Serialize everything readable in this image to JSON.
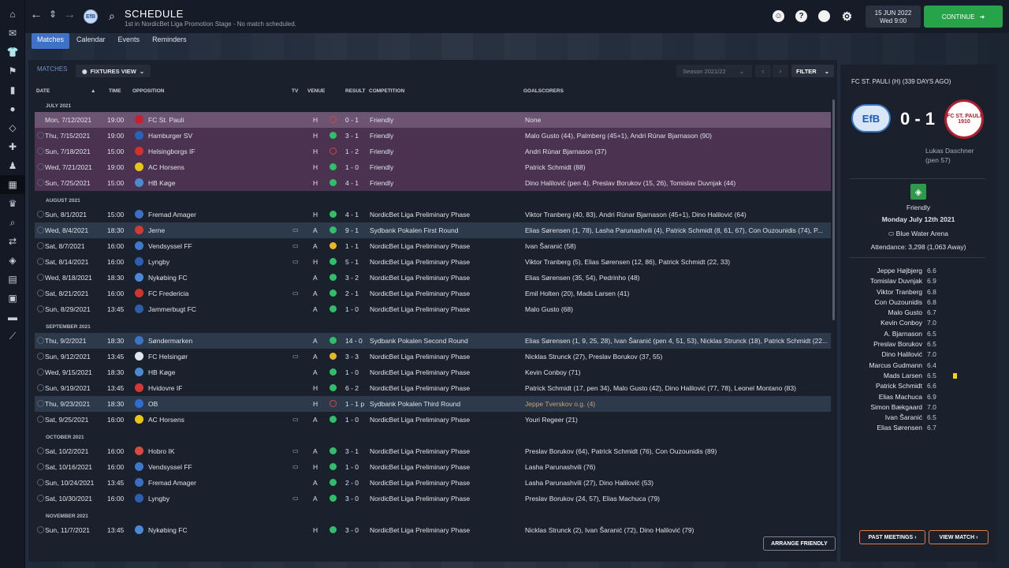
{
  "header": {
    "title": "SCHEDULE",
    "subtitle": "1st in NordicBet Liga Promotion Stage - No match scheduled.",
    "date": "15 JUN 2022",
    "day_time": "Wed 9:00",
    "continue_label": "CONTINUE",
    "club_badge_text": "EfB"
  },
  "tabs": [
    "Matches",
    "Calendar",
    "Events",
    "Reminders"
  ],
  "main": {
    "section_label": "MATCHES",
    "view_label": "FIXTURES VIEW",
    "season": "Season 2021/22",
    "filter_label": "FILTER",
    "arrange_label": "ARRANGE FRIENDLY",
    "columns": {
      "date": "DATE",
      "time": "TIME",
      "opposition": "OPPOSITION",
      "tv": "TV",
      "venue": "VENUE",
      "result": "RESULT",
      "competition": "COMPETITION",
      "goalscorers": "GOALSCORERS"
    }
  },
  "months": [
    {
      "label": "JULY 2021",
      "matches": [
        {
          "date": "Mon, 7/12/2021",
          "time": "19:00",
          "opp": "FC St. Pauli",
          "badge": "#c8202f",
          "tv": "",
          "venue": "H",
          "res": "L",
          "score": "0 - 1",
          "comp": "Friendly",
          "goals": "None",
          "style": "friendly sel"
        },
        {
          "date": "Thu, 7/15/2021",
          "time": "19:00",
          "opp": "Hamburger SV",
          "badge": "#2a62b8",
          "tv": "",
          "venue": "H",
          "res": "W",
          "score": "3 - 1",
          "comp": "Friendly",
          "goals": "Malo Gusto (44), Palmberg (45+1), Andri Rúnar Bjarnason (90)",
          "style": "friendly"
        },
        {
          "date": "Sun, 7/18/2021",
          "time": "15:00",
          "opp": "Helsingborgs IF",
          "badge": "#d3312d",
          "tv": "",
          "venue": "H",
          "res": "L",
          "score": "1 - 2",
          "comp": "Friendly",
          "goals": "Andri Rúnar Bjarnason (37)",
          "style": "friendly"
        },
        {
          "date": "Wed, 7/21/2021",
          "time": "19:00",
          "opp": "AC Horsens",
          "badge": "#e6c619",
          "tv": "",
          "venue": "H",
          "res": "W",
          "score": "1 - 0",
          "comp": "Friendly",
          "goals": "Patrick Schmidt (88)",
          "style": "friendly"
        },
        {
          "date": "Sun, 7/25/2021",
          "time": "15:00",
          "opp": "HB Køge",
          "badge": "#4a8ad0",
          "tv": "",
          "venue": "H",
          "res": "W",
          "score": "4 - 1",
          "comp": "Friendly",
          "goals": "Dino Halilović (pen 4), Preslav Borukov (15, 26), Tomislav Duvnjak (44)",
          "style": "friendly"
        }
      ]
    },
    {
      "label": "AUGUST 2021",
      "matches": [
        {
          "date": "Sun, 8/1/2021",
          "time": "15:00",
          "opp": "Fremad Amager",
          "badge": "#3a6fc4",
          "tv": "",
          "venue": "H",
          "res": "W",
          "score": "4 - 1",
          "comp": "NordicBet Liga Preliminary Phase",
          "goals": "Viktor Tranberg (40, 83), Andri Rúnar Bjarnason (45+1), Dino Halilović (64)",
          "style": ""
        },
        {
          "date": "Wed, 8/4/2021",
          "time": "18:30",
          "opp": "Jerne",
          "badge": "#d23a34",
          "tv": "▭",
          "venue": "A",
          "res": "W",
          "score": "9 - 1",
          "comp": "Sydbank Pokalen First Round",
          "goals": "Elias Sørensen (1, 78), Lasha Parunashvili (4), Patrick Schmidt (8, 61, 67), Con Ouzounidis (74), P...",
          "style": "cup"
        },
        {
          "date": "Sat, 8/7/2021",
          "time": "16:00",
          "opp": "Vendsyssel FF",
          "badge": "#3d78cc",
          "tv": "▭",
          "venue": "A",
          "res": "D",
          "score": "1 - 1",
          "comp": "NordicBet Liga Preliminary Phase",
          "goals": "Ivan Šaranić (58)",
          "style": ""
        },
        {
          "date": "Sat, 8/14/2021",
          "time": "16:00",
          "opp": "Lyngby",
          "badge": "#2c5fb0",
          "tv": "▭",
          "venue": "H",
          "res": "W",
          "score": "5 - 1",
          "comp": "NordicBet Liga Preliminary Phase",
          "goals": "Viktor Tranberg (5), Elias Sørensen (12, 86), Patrick Schmidt (22, 33)",
          "style": ""
        },
        {
          "date": "Wed, 8/18/2021",
          "time": "18:30",
          "opp": "Nykøbing FC",
          "badge": "#4a88d8",
          "tv": "",
          "venue": "A",
          "res": "W",
          "score": "3 - 2",
          "comp": "NordicBet Liga Preliminary Phase",
          "goals": "Elias Sørensen (35, 54), Pedrinho (48)",
          "style": ""
        },
        {
          "date": "Sat, 8/21/2021",
          "time": "16:00",
          "opp": "FC Fredericia",
          "badge": "#d0342e",
          "tv": "▭",
          "venue": "A",
          "res": "W",
          "score": "2 - 1",
          "comp": "NordicBet Liga Preliminary Phase",
          "goals": "Emil Holten (20), Mads Larsen (41)",
          "style": ""
        },
        {
          "date": "Sun, 8/29/2021",
          "time": "13:45",
          "opp": "Jammerbugt FC",
          "badge": "#2d5ea8",
          "tv": "",
          "venue": "A",
          "res": "W",
          "score": "1 - 0",
          "comp": "NordicBet Liga Preliminary Phase",
          "goals": "Malo Gusto (68)",
          "style": ""
        }
      ]
    },
    {
      "label": "SEPTEMBER 2021",
      "matches": [
        {
          "date": "Thu, 9/2/2021",
          "time": "18:30",
          "opp": "Søndermarken",
          "badge": "#3a74c8",
          "tv": "",
          "venue": "A",
          "res": "W",
          "score": "14 - 0",
          "comp": "Sydbank Pokalen Second Round",
          "goals": "Elias Sørensen (1, 9, 25, 28), Ivan Šaranić (pen 4, 51, 53), Nicklas Strunck (18), Patrick Schmidt (22...",
          "style": "cup"
        },
        {
          "date": "Sun, 9/12/2021",
          "time": "13:45",
          "opp": "FC Helsingør",
          "badge": "#e0e6ee",
          "tv": "▭",
          "venue": "A",
          "res": "D",
          "score": "3 - 3",
          "comp": "NordicBet Liga Preliminary Phase",
          "goals": "Nicklas Strunck (27), Preslav Borukov (37, 55)",
          "style": ""
        },
        {
          "date": "Wed, 9/15/2021",
          "time": "18:30",
          "opp": "HB Køge",
          "badge": "#4a8ad0",
          "tv": "",
          "venue": "A",
          "res": "W",
          "score": "1 - 0",
          "comp": "NordicBet Liga Preliminary Phase",
          "goals": "Kevin Conboy (71)",
          "style": ""
        },
        {
          "date": "Sun, 9/19/2021",
          "time": "13:45",
          "opp": "Hvidovre IF",
          "badge": "#d43a33",
          "tv": "",
          "venue": "H",
          "res": "W",
          "score": "6 - 2",
          "comp": "NordicBet Liga Preliminary Phase",
          "goals": "Patrick Schmidt (17, pen 34), Malo Gusto (42), Dino Halilović (77, 78), Leonel Montano (83)",
          "style": ""
        },
        {
          "date": "Thu, 9/23/2021",
          "time": "18:30",
          "opp": "OB",
          "badge": "#2f6ed0",
          "tv": "",
          "venue": "H",
          "res": "L",
          "score": "1 - 1 p",
          "comp": "Sydbank Pokalen Third Round",
          "goals": "Jeppe Tverskov o.g. (4)",
          "style": "cup og"
        },
        {
          "date": "Sat, 9/25/2021",
          "time": "16:00",
          "opp": "AC Horsens",
          "badge": "#e6c619",
          "tv": "▭",
          "venue": "A",
          "res": "W",
          "score": "1 - 0",
          "comp": "NordicBet Liga Preliminary Phase",
          "goals": "Youri Regeer (21)",
          "style": ""
        }
      ]
    },
    {
      "label": "OCTOBER 2021",
      "matches": [
        {
          "date": "Sat, 10/2/2021",
          "time": "16:00",
          "opp": "Hobro IK",
          "badge": "#d74a3f",
          "tv": "▭",
          "venue": "A",
          "res": "W",
          "score": "3 - 1",
          "comp": "NordicBet Liga Preliminary Phase",
          "goals": "Preslav Borukov (64), Patrick Schmidt (76), Con Ouzounidis (89)",
          "style": ""
        },
        {
          "date": "Sat, 10/16/2021",
          "time": "16:00",
          "opp": "Vendsyssel FF",
          "badge": "#3d78cc",
          "tv": "▭",
          "venue": "H",
          "res": "W",
          "score": "1 - 0",
          "comp": "NordicBet Liga Preliminary Phase",
          "goals": "Lasha Parunashvili (76)",
          "style": ""
        },
        {
          "date": "Sun, 10/24/2021",
          "time": "13:45",
          "opp": "Fremad Amager",
          "badge": "#3a6fc4",
          "tv": "",
          "venue": "A",
          "res": "W",
          "score": "2 - 0",
          "comp": "NordicBet Liga Preliminary Phase",
          "goals": "Lasha Parunashvili (27), Dino Halilović (53)",
          "style": ""
        },
        {
          "date": "Sat, 10/30/2021",
          "time": "16:00",
          "opp": "Lyngby",
          "badge": "#2c5fb0",
          "tv": "▭",
          "venue": "A",
          "res": "W",
          "score": "3 - 0",
          "comp": "NordicBet Liga Preliminary Phase",
          "goals": "Preslav Borukov (24, 57), Elias Machuca (79)",
          "style": ""
        }
      ]
    },
    {
      "label": "NOVEMBER 2021",
      "matches": [
        {
          "date": "Sun, 11/7/2021",
          "time": "13:45",
          "opp": "Nykøbing FC",
          "badge": "#4a88d8",
          "tv": "",
          "venue": "H",
          "res": "W",
          "score": "3 - 0",
          "comp": "NordicBet Liga Preliminary Phase",
          "goals": "Nicklas Strunck (2), Ivan Šaranić (72), Dino Halilović (79)",
          "style": ""
        }
      ]
    }
  ],
  "panel": {
    "title": "FC ST. PAULI (H) (339 DAYS AGO)",
    "score": "0 - 1",
    "home_crest_text": "EfB",
    "away_crest_text": "FC ST. PAULI 1910",
    "scorer": "Lukas Daschner",
    "scorer_note": "(pen 57)",
    "competition": "Friendly",
    "match_date": "Monday July 12th 2021",
    "stadium": "Blue Water Arena",
    "attendance": "Attendance: 3,298 (1,063 Away)",
    "players": [
      {
        "name": "Jeppe Højbjerg",
        "rating": "6.6"
      },
      {
        "name": "Tomislav Duvnjak",
        "rating": "6.9"
      },
      {
        "name": "Viktor Tranberg",
        "rating": "6.8"
      },
      {
        "name": "Con Ouzounidis",
        "rating": "6.8"
      },
      {
        "name": "Malo Gusto",
        "rating": "6.7"
      },
      {
        "name": "Kevin Conboy",
        "rating": "7.0"
      },
      {
        "name": "A. Bjarnason",
        "rating": "6.5"
      },
      {
        "name": "Preslav Borukov",
        "rating": "6.5"
      },
      {
        "name": "Dino Halilović",
        "rating": "7.0"
      },
      {
        "name": "Marcus Gudmann",
        "rating": "6.4"
      },
      {
        "name": "Mads Larsen",
        "rating": "6.5",
        "card": "yellow"
      },
      {
        "name": "Patrick Schmidt",
        "rating": "6.6"
      },
      {
        "name": "Elias Machuca",
        "rating": "6.9"
      },
      {
        "name": "Simon Bækgaard",
        "rating": "7.0"
      },
      {
        "name": "Ivan Šaranić",
        "rating": "6.5"
      },
      {
        "name": "Elias Sørensen",
        "rating": "6.7"
      }
    ],
    "past_meetings_label": "PAST MEETINGS",
    "view_match_label": "VIEW MATCH"
  }
}
